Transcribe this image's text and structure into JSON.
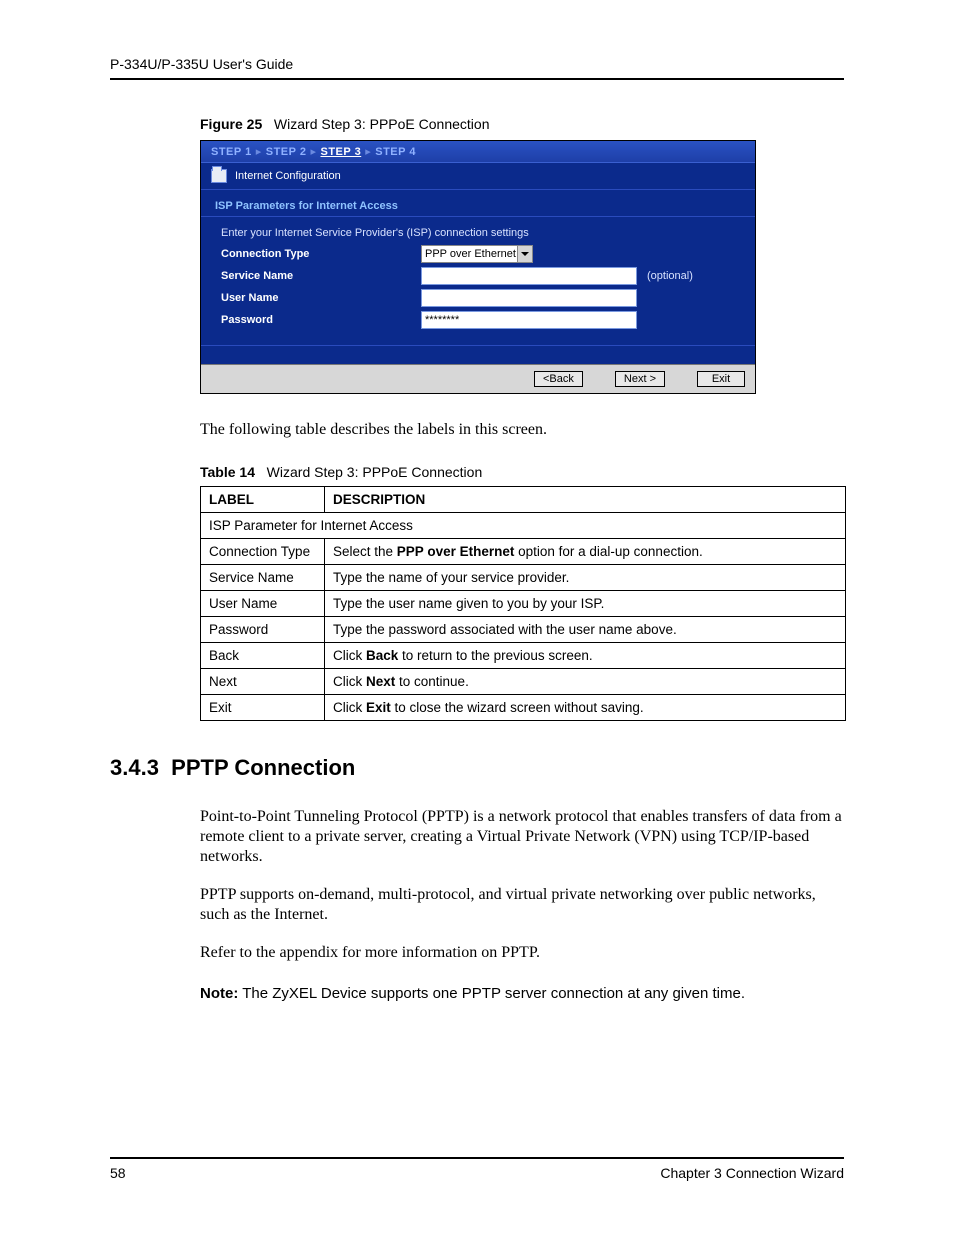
{
  "header": {
    "doc_title": "P-334U/P-335U User's Guide"
  },
  "figure": {
    "label": "Figure 25",
    "caption": "Wizard Step 3: PPPoE Connection"
  },
  "wizard": {
    "steps": {
      "s1": "STEP 1",
      "s2": "STEP 2",
      "s3": "STEP 3",
      "s4": "STEP 4"
    },
    "title": "Internet Configuration",
    "section_heading": "ISP Parameters for Internet Access",
    "instruction": "Enter your Internet Service Provider's (ISP) connection settings",
    "rows": {
      "connection_type": {
        "label": "Connection Type",
        "value": "PPP over Ethernet"
      },
      "service_name": {
        "label": "Service Name",
        "value": "",
        "optional": "(optional)"
      },
      "user_name": {
        "label": "User Name",
        "value": ""
      },
      "password": {
        "label": "Password",
        "value": "********"
      }
    },
    "buttons": {
      "back": "<Back",
      "next": "Next >",
      "exit": "Exit"
    }
  },
  "intro_para": "The following table describes the labels in this screen.",
  "table": {
    "label": "Table 14",
    "caption": "Wizard Step 3: PPPoE Connection",
    "headers": {
      "c1": "LABEL",
      "c2": "DESCRIPTION"
    },
    "span_row": "ISP Parameter for Internet Access",
    "rows": [
      {
        "label": "Connection Type",
        "desc_pre": "Select the ",
        "desc_bold": "PPP over Ethernet",
        "desc_post": " option for a dial-up connection."
      },
      {
        "label": "Service Name",
        "desc_pre": "Type the name of your service provider.",
        "desc_bold": "",
        "desc_post": ""
      },
      {
        "label": "User Name",
        "desc_pre": "Type the user name given to you by your ISP.",
        "desc_bold": "",
        "desc_post": ""
      },
      {
        "label": "Password",
        "desc_pre": "Type the password associated with the user name above.",
        "desc_bold": "",
        "desc_post": ""
      },
      {
        "label": "Back",
        "desc_pre": "Click ",
        "desc_bold": "Back",
        "desc_post": " to return to the previous screen."
      },
      {
        "label": "Next",
        "desc_pre": "Click ",
        "desc_bold": "Next",
        "desc_post": " to continue."
      },
      {
        "label": "Exit",
        "desc_pre": "Click ",
        "desc_bold": "Exit",
        "desc_post": " to close the wizard screen without saving."
      }
    ]
  },
  "section": {
    "number": "3.4.3",
    "title": "PPTP Connection",
    "p1": "Point-to-Point Tunneling Protocol (PPTP) is a network protocol that enables transfers of data from a remote client to a private server, creating a Virtual Private Network (VPN) using TCP/IP-based networks.",
    "p2": "PPTP supports on-demand, multi-protocol, and virtual private networking over public networks, such as the Internet.",
    "p3": "Refer to the appendix for more information on PPTP.",
    "note_label": "Note:",
    "note_text": "The ZyXEL Device supports one PPTP server connection at any given time."
  },
  "footer": {
    "page": "58",
    "chapter": "Chapter 3 Connection Wizard"
  }
}
